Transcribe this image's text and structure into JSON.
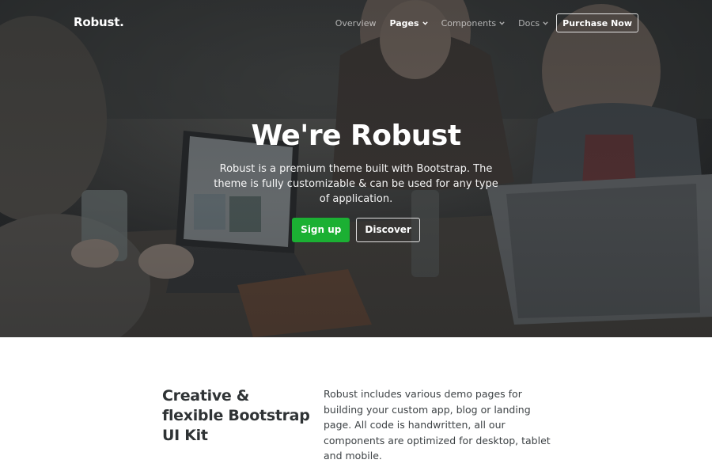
{
  "navbar": {
    "brand": "Robust.",
    "links": [
      {
        "label": "Overview",
        "has_dropdown": false,
        "active": false
      },
      {
        "label": "Pages",
        "has_dropdown": true,
        "active": true
      },
      {
        "label": "Components",
        "has_dropdown": true,
        "active": false
      },
      {
        "label": "Docs",
        "has_dropdown": true,
        "active": false
      }
    ],
    "cta_label": "Purchase Now"
  },
  "hero": {
    "title": "We're Robust",
    "subtitle": "Robust is a premium theme built with Bootstrap. The theme is fully customizable & can be used for any type of application.",
    "primary_button": "Sign up",
    "secondary_button": "Discover"
  },
  "feature": {
    "title": "Creative & flexible Bootstrap UI Kit",
    "text": "Robust includes various demo pages for building your custom app, blog or landing page. All code is handwritten, all our components are optimized for desktop, tablet and mobile."
  },
  "colors": {
    "primary": "#1bb033",
    "hero_overlay": "#141618",
    "heading_text": "#2f3335",
    "body_text": "#3d4245"
  },
  "icons": [
    "chevron-down-icon"
  ]
}
